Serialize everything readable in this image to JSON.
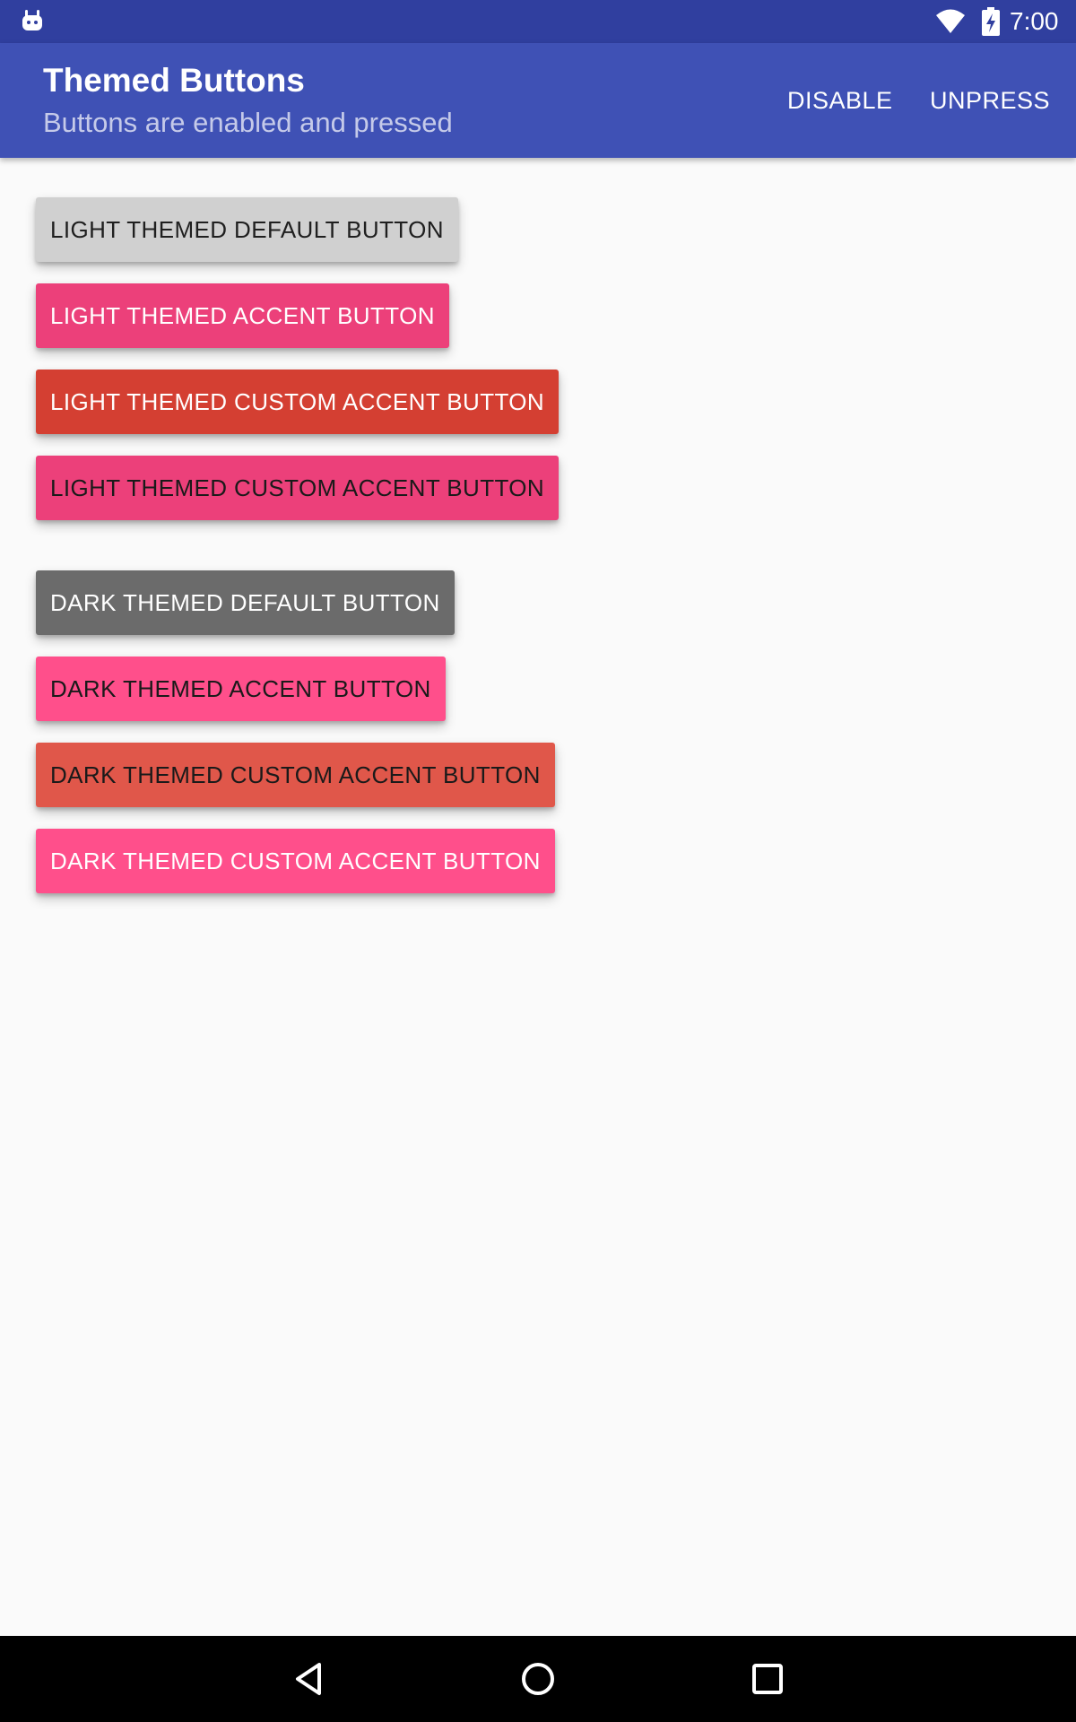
{
  "status_bar": {
    "time": "7:00",
    "icons": [
      "android-icon",
      "wifi-icon",
      "battery-charging-icon"
    ]
  },
  "app_bar": {
    "title": "Themed Buttons",
    "subtitle": "Buttons are enabled and pressed",
    "actions": {
      "disable": "DISABLE",
      "unpress": "UNPRESS"
    }
  },
  "colors": {
    "status_bar": "#303f9f",
    "app_bar": "#3f51b5",
    "background": "#fafafa"
  },
  "buttons": [
    {
      "label": "LIGHT THEMED DEFAULT BUTTON",
      "bg": "#d0d0d0",
      "fg": "#1f1f1f"
    },
    {
      "label": "LIGHT THEMED ACCENT BUTTON",
      "bg": "#ec407a",
      "fg": "#ffffff"
    },
    {
      "label": "LIGHT THEMED CUSTOM ACCENT BUTTON",
      "bg": "#d43f32",
      "fg": "#ffffff"
    },
    {
      "label": "LIGHT THEMED CUSTOM ACCENT BUTTON",
      "bg": "#ec407a",
      "fg": "#1a1a1a"
    },
    {
      "label": "DARK THEMED DEFAULT BUTTON",
      "bg": "#6b6b6b",
      "fg": "#ffffff"
    },
    {
      "label": "DARK THEMED ACCENT BUTTON",
      "bg": "#ff4f8b",
      "fg": "#1a1a1a"
    },
    {
      "label": "DARK THEMED CUSTOM ACCENT BUTTON",
      "bg": "#e0574a",
      "fg": "#1a1a1a"
    },
    {
      "label": "DARK THEMED CUSTOM ACCENT BUTTON",
      "bg": "#ff4f8b",
      "fg": "#ffffff"
    }
  ],
  "nav_bar": {
    "icons": [
      "back-icon",
      "home-icon",
      "recents-icon"
    ]
  }
}
